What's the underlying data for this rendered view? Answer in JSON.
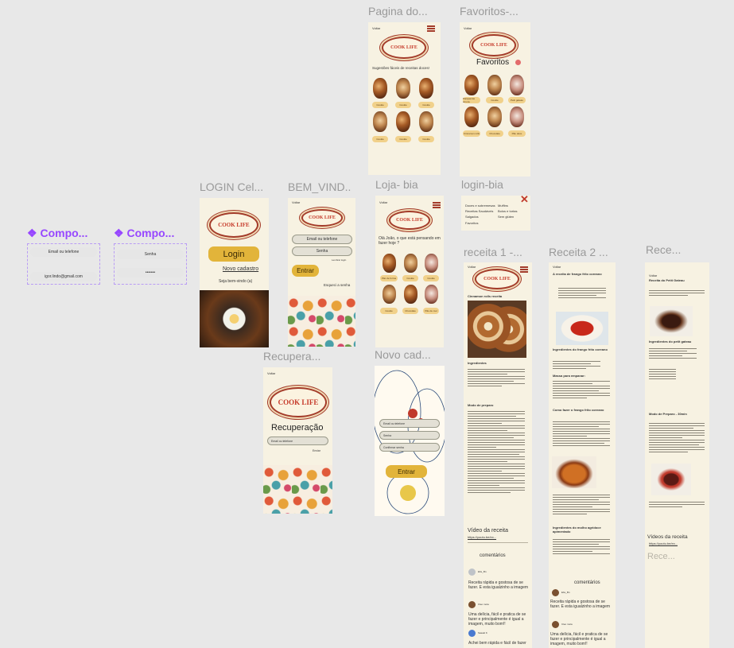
{
  "frames": {
    "pagina_do": "Pagina do...",
    "favoritos": "Favoritos-...",
    "login_cel": "LOGIN Cel...",
    "bem_vindo": "BEM_VIND...",
    "loja_bia": "Loja- bia",
    "login_bia": "login-bia",
    "recuperacao": "Recupera...",
    "novo_cad": "Novo cad...",
    "receita1": "receita 1 -...",
    "receita2": "Receita 2 ...",
    "rece": "Rece..."
  },
  "components": {
    "comp1": "Compo...",
    "comp2": "Compo..."
  },
  "comp1": {
    "email_placeholder": "Email ou telefone",
    "email_value": "igor.lindo@gmail.com"
  },
  "comp2": {
    "senha_placeholder": "Senha",
    "senha_value": "•••••••"
  },
  "brand": {
    "logo": "COOK LIFE"
  },
  "common": {
    "back": "Voltar"
  },
  "pagina": {
    "subtitle": "Sugestões fáceis de receitas doces!",
    "pills": [
      "Cookie",
      "Cookie",
      "Cookie",
      "Cookie",
      "Cookie",
      "Cookie"
    ]
  },
  "favoritos": {
    "title": "Favoritos",
    "pills": [
      "Panquecas amora",
      "Cookie",
      "Petit gateau",
      "Cinnamon rolls",
      "Chocolate",
      "Pão doce"
    ]
  },
  "login": {
    "login_button": "Login",
    "new_account": "Novo cadastro",
    "welcome": "Seja bem-vindo (a)"
  },
  "bemvindo": {
    "email": "Email ou telefone",
    "senha": "Senha",
    "remember": "Lembrar login",
    "enter": "Entrar",
    "forgot": "Esqueci a senha"
  },
  "loja": {
    "greeting": "Olá João, o que está pensando em fazer hoje ?",
    "pills": [
      "Pão de forma",
      "Cookie",
      "Cookie",
      "Cookie",
      "Chocolate",
      "Pão de mel"
    ]
  },
  "loginbia": {
    "items": [
      "Doces e sobremesas",
      "Receitas Saudáveis",
      "Salgados",
      "Favoritos",
      "Muffins",
      "Bolos e tortas",
      "Sem glúten"
    ]
  },
  "recuperacao": {
    "title": "Recuperação",
    "email": "Email ou telefone",
    "send": "Enviar"
  },
  "novo": {
    "name": "Email ou telefone",
    "senha": "Senha",
    "confirm": "Confirmar senha",
    "enter": "Entrar"
  },
  "receita1": {
    "title": "Cinnamon rolls receita",
    "ingredients": "Ingredientes",
    "prep": "Modo de preparo",
    "video": "Vídeo da receita",
    "link": "https://youtu.be/ex...",
    "comments": "comentários",
    "c1_name": "Ebs_Bn",
    "c1_text": "Receita rápida e gostosa de se fazer. E esta igualzinho a imagem",
    "c2_name": "Cleo mota",
    "c2_text": "Uma delícia, fácil e pratica de se fazer e principalmente é igual a imagem, muito bom!!",
    "c3_name": "Sasaki K",
    "c3_text": "Achei bem rápida e fácil de fazer"
  },
  "receita2": {
    "title": "A receita de frango frito coreano",
    "sec1": "Ingredientes do frango frito coreano",
    "sec2": "Massa para empanar:",
    "sec3": "Como fazer o frango frito coreano",
    "sec4": "Ingredientes do molho agridoce apimentado",
    "comments": "comentários",
    "c1_name": "Ebs_Bn",
    "c2_text": "Receita rápida e gostosa de se fazer. E esta igualzinho a imagem",
    "c3_name": "Cleo mota",
    "c3_text": "Uma delícia, fácil e pratica de se fazer e principalmente é igual a imagem, muito bom!!"
  },
  "receita3": {
    "title": "Receita do Petit Gateau",
    "ing": "Ingredientes do petit gateau",
    "prep": "Modo de Preparo - 30min",
    "video": "Vídeos da receita",
    "link": "https://youtu.be/ex...",
    "rece": "Rece..."
  }
}
